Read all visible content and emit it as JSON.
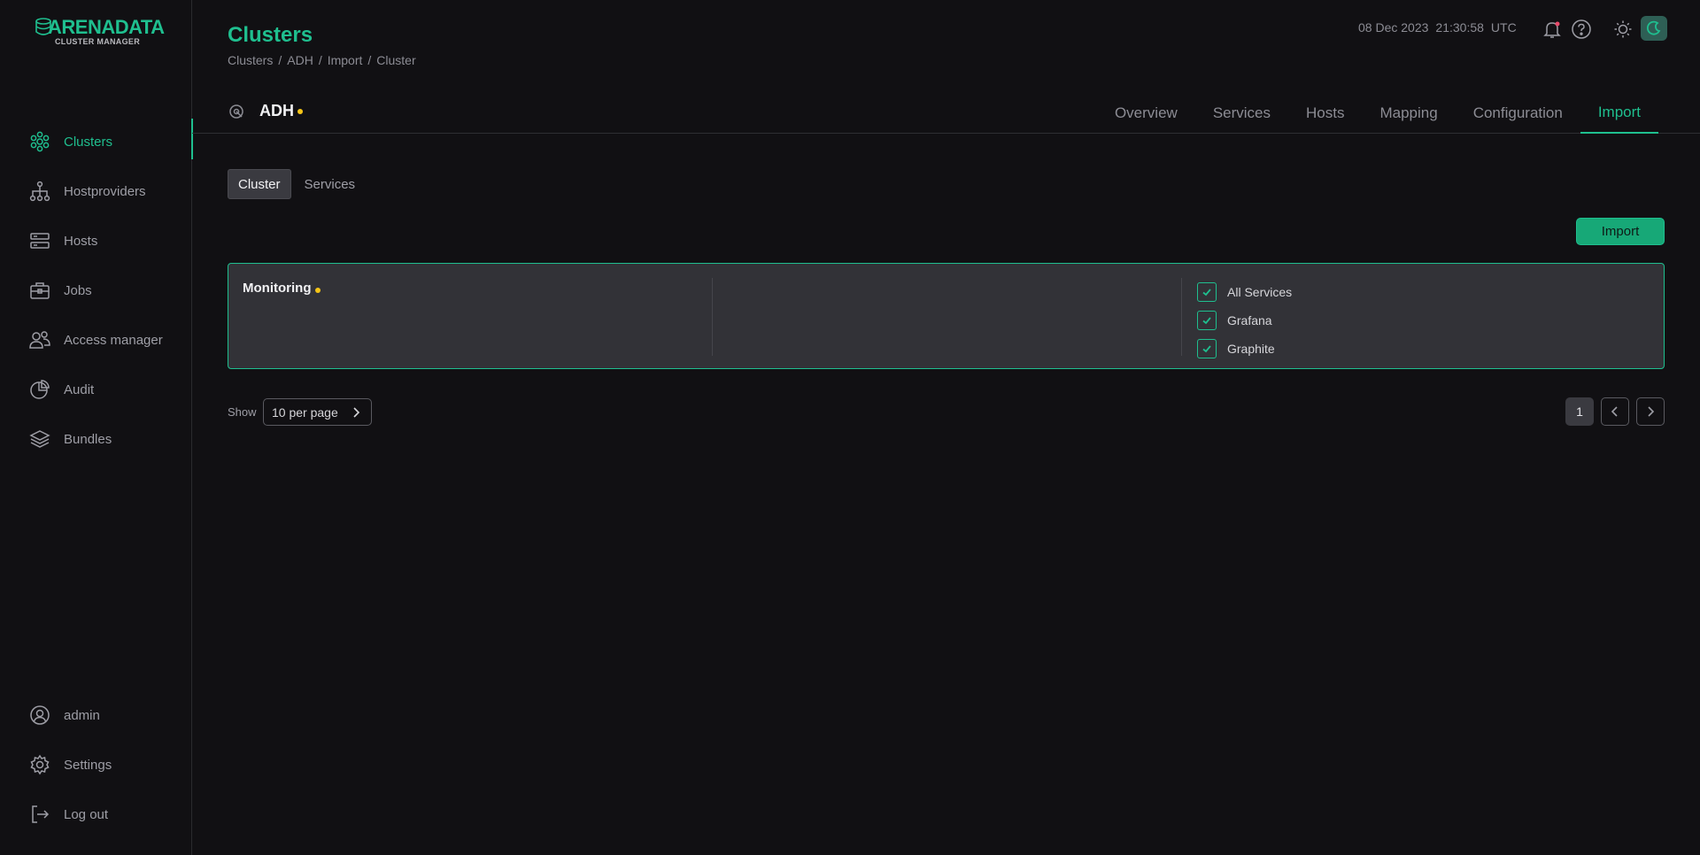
{
  "logo": {
    "brand": "ARENADATA",
    "subtitle": "CLUSTER MANAGER"
  },
  "sidebar": {
    "items": [
      {
        "label": "Clusters",
        "icon": "clusters-icon",
        "active": true
      },
      {
        "label": "Hostproviders",
        "icon": "hostproviders-icon"
      },
      {
        "label": "Hosts",
        "icon": "hosts-icon"
      },
      {
        "label": "Jobs",
        "icon": "jobs-icon"
      },
      {
        "label": "Access manager",
        "icon": "access-manager-icon"
      },
      {
        "label": "Audit",
        "icon": "audit-icon"
      },
      {
        "label": "Bundles",
        "icon": "bundles-icon"
      }
    ],
    "bottom": [
      {
        "label": "admin",
        "icon": "user-icon"
      },
      {
        "label": "Settings",
        "icon": "gear-icon"
      },
      {
        "label": "Log out",
        "icon": "logout-icon"
      }
    ]
  },
  "header": {
    "title": "Clusters",
    "breadcrumbs": [
      "Clusters",
      "ADH",
      "Import",
      "Cluster"
    ],
    "date": "08 Dec 2023",
    "time": "21:30:58",
    "timezone": "UTC"
  },
  "entity": {
    "name": "ADH",
    "tabs": [
      "Overview",
      "Services",
      "Hosts",
      "Mapping",
      "Configuration",
      "Import"
    ],
    "active_tab": "Import"
  },
  "subtabs": [
    "Cluster",
    "Services"
  ],
  "import_button": "Import",
  "import_card": {
    "title": "Monitoring",
    "services": [
      "All Services",
      "Grafana",
      "Graphite"
    ]
  },
  "pagination": {
    "show_label": "Show",
    "per_page": "10 per page",
    "current_page": "1"
  },
  "colors": {
    "accent": "#1fbf8f",
    "background": "#111013",
    "card": "#323237",
    "warning_dot": "#f5c518"
  }
}
